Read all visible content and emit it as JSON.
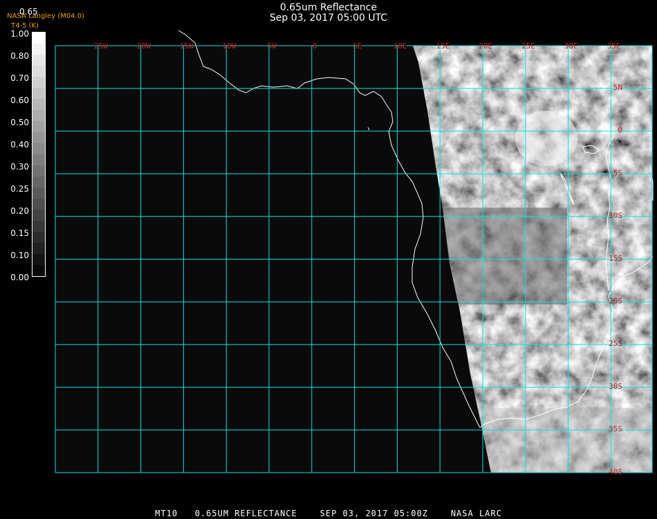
{
  "header": {
    "title": "0.65um Reflectance",
    "datetime": "Sep 03, 2017 05:00 UTC",
    "source": "NASA Langley (M04.0)",
    "subtitle": "T4-5 (K)",
    "colorbar_top": "0.65"
  },
  "colorbar": {
    "labels": [
      "1.00",
      "0.80",
      "0.70",
      "0.60",
      "0.50",
      "0.40",
      "0.30",
      "0.25",
      "0.20",
      "0.15",
      "0.10",
      "0.00"
    ]
  },
  "map": {
    "lon_labels": [
      "25W",
      "20W",
      "15W",
      "10W",
      "5W",
      "0",
      "5E",
      "10E",
      "15E",
      "20E",
      "25E",
      "30E",
      "35E"
    ],
    "lat_labels": [
      "5N",
      "0",
      "5S",
      "10S",
      "15S",
      "20S",
      "25S",
      "30S",
      "35S",
      "40S"
    ],
    "grid_color": "#00e5e5",
    "label_color": "#cc2222"
  },
  "footer": {
    "text": "MT10   0.65UM REFLECTANCE    SEP 03, 2017 05:00Z    NASA LARC"
  }
}
